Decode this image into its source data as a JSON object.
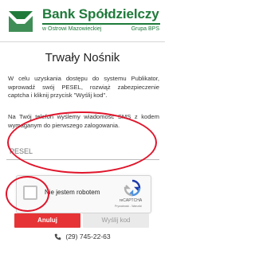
{
  "header": {
    "bank_name": "Bank Spółdzielczy",
    "location": "w Ostrowi Mazowieckiej",
    "group": "Grupa BPS"
  },
  "page": {
    "title": "Trwały Nośnik",
    "instructions": "W celu uzyskania dostępu do systemu Publikator, wprowadź swój PESEL, rozwiąż zabezpieczenie captcha i kliknij przycisk \"Wyślij kod\".",
    "sms_info": "Na Twój telefon wyślemy wiadomość SMS z kodem wymaganym do pierwszego zalogowania."
  },
  "form": {
    "pesel_placeholder": "PESEL",
    "pesel_value": ""
  },
  "captcha": {
    "label": "Nie jestem robotem",
    "brand": "reCAPTCHA",
    "links": "Prywatność - Warunki"
  },
  "buttons": {
    "cancel": "Anuluj",
    "send": "Wyślij kod"
  },
  "contact": {
    "phone": "(29) 745-22-63"
  },
  "colors": {
    "brand_green": "#1f7a3a",
    "cancel_red": "#e63436",
    "annotation_red": "#e0152b"
  }
}
